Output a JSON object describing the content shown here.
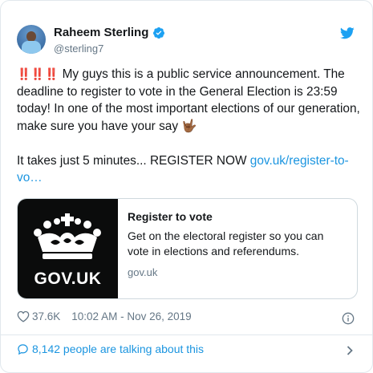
{
  "tweet": {
    "display_name": "Raheem Sterling",
    "handle": "@sterling7",
    "emphasis_emoji": "‼️‼️‼️",
    "text_main": " My guys this is a public service announcement. The deadline to register to vote in the General Election is 23:59 today! In one of the most important elections of our generation, make sure you have your say ",
    "hand_emoji": "🤟🏾",
    "text_cta": "It takes just 5 minutes... REGISTER NOW ",
    "link_text": "gov.uk/register-to-vo…",
    "likes": "37.6K",
    "timestamp": "10:02 AM - Nov 26, 2019",
    "talking_text": "8,142 people are talking about this"
  },
  "link_card": {
    "logo_word": "GOV.UK",
    "title": "Register to vote",
    "description": "Get on the electoral register so you can vote in elections and referendums.",
    "domain": "gov.uk"
  },
  "icons": {
    "verified": "verified-badge-icon",
    "brand": "twitter-bird-icon",
    "like": "heart-icon",
    "info": "info-icon",
    "talk": "speech-bubble-icon",
    "more": "chevron-right-icon"
  },
  "colors": {
    "link_blue": "#1b95e0",
    "twitter_blue": "#1da1f2",
    "secondary_text": "#657786",
    "gov_black": "#0b0c0c"
  }
}
